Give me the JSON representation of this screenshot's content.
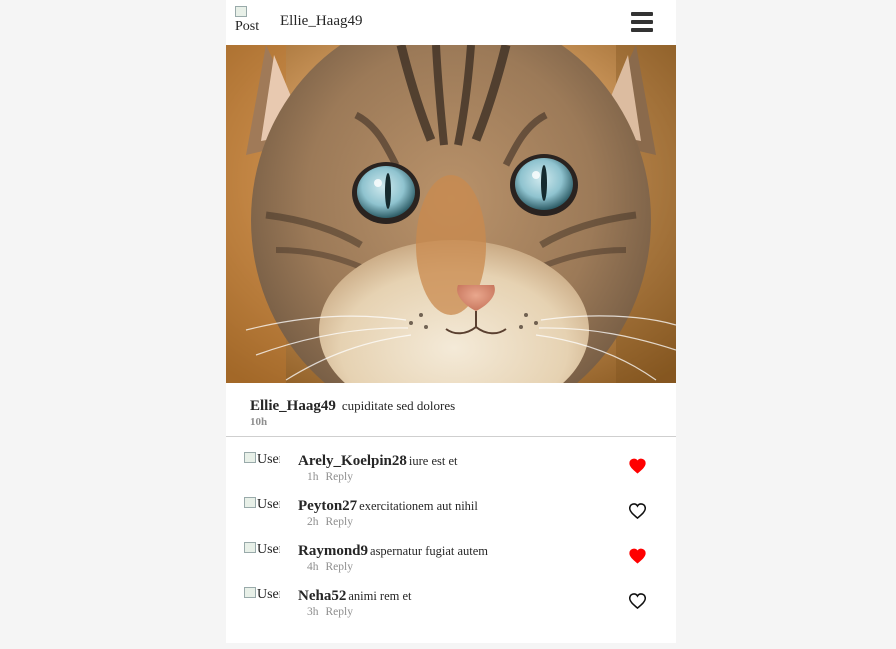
{
  "header": {
    "avatar_alt": "Post",
    "username": "Ellie_Haag49",
    "menu_icon": "hamburger-menu-icon"
  },
  "post": {
    "image_subject": "cat-photo",
    "caption_user": "Ellie_Haag49",
    "caption_text": "cupiditate sed dolores",
    "time": "10h"
  },
  "colors": {
    "liked": "#ff0000",
    "muted": "#8e8e8e",
    "text": "#262626"
  },
  "comments": [
    {
      "avatar_alt": "User Comment",
      "user": "Arely_Koelpin28",
      "text": "iure est et",
      "time": "1h",
      "reply": "Reply",
      "liked": true
    },
    {
      "avatar_alt": "User Comment",
      "user": "Peyton27",
      "text": "exercitationem aut nihil",
      "time": "2h",
      "reply": "Reply",
      "liked": false
    },
    {
      "avatar_alt": "User Comment",
      "user": "Raymond9",
      "text": "aspernatur fugiat autem",
      "time": "4h",
      "reply": "Reply",
      "liked": true
    },
    {
      "avatar_alt": "User Comment",
      "user": "Neha52",
      "text": "animi rem et",
      "time": "3h",
      "reply": "Reply",
      "liked": false
    }
  ]
}
